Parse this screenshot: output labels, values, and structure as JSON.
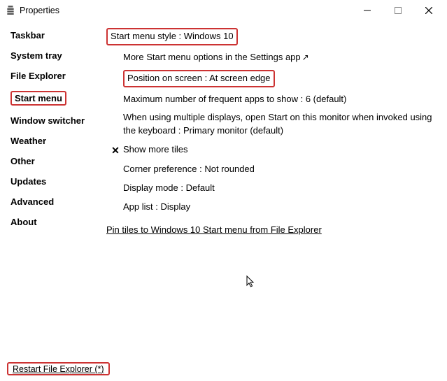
{
  "window": {
    "title": "Properties"
  },
  "sidebar": {
    "items": [
      {
        "label": "Taskbar"
      },
      {
        "label": "System tray"
      },
      {
        "label": "File Explorer"
      },
      {
        "label": "Start menu",
        "active": true,
        "highlighted": true
      },
      {
        "label": "Window switcher"
      },
      {
        "label": "Weather"
      },
      {
        "label": "Other"
      },
      {
        "label": "Updates"
      },
      {
        "label": "Advanced"
      },
      {
        "label": "About"
      }
    ]
  },
  "main": {
    "style_row": "Start menu style : Windows 10",
    "more_options": "More Start menu options in the Settings app",
    "position_row": "Position on screen : At screen edge",
    "max_apps": "Maximum number of frequent apps to show : 6 (default)",
    "multi_display": "When using multiple displays, open Start on this monitor when invoked using the keyboard : Primary monitor (default)",
    "show_more_tiles": "Show more tiles",
    "corner_pref": "Corner preference : Not rounded",
    "display_mode": "Display mode : Default",
    "app_list": "App list : Display",
    "pin_link": "Pin tiles to Windows 10 Start menu from File Explorer"
  },
  "footer": {
    "restart": "Restart File Explorer (*)"
  }
}
